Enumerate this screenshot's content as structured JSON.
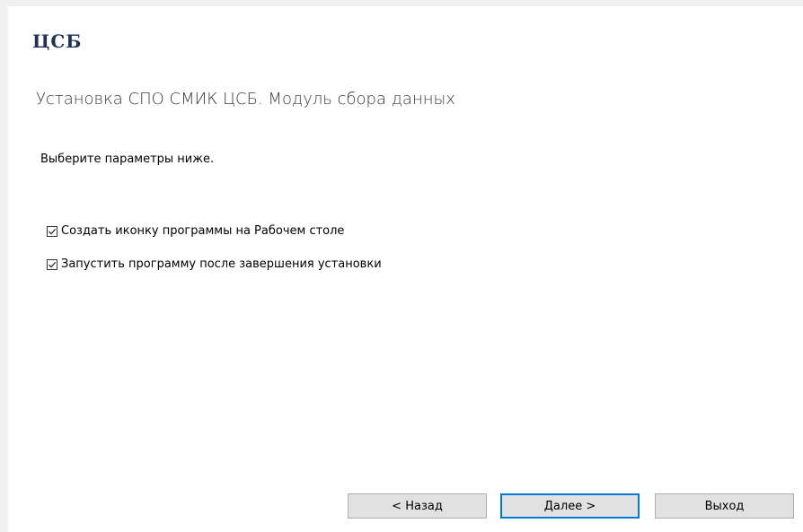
{
  "logo": {
    "text": "ЦСБ"
  },
  "title": "Установка СПО СМИК ЦСБ. Модуль сбора данных",
  "subtitle": "Выберите параметры ниже.",
  "options": [
    {
      "label": "Создать иконку программы на Рабочем столе",
      "checked": true
    },
    {
      "label": "Запустить программу после завершения установки",
      "checked": true
    }
  ],
  "buttons": {
    "back": "< Назад",
    "next": "Далее >",
    "exit": "Выход"
  },
  "colors": {
    "accent": "#0078d7",
    "logo": "#1f2f55",
    "button_bg": "#e1e1e1"
  }
}
